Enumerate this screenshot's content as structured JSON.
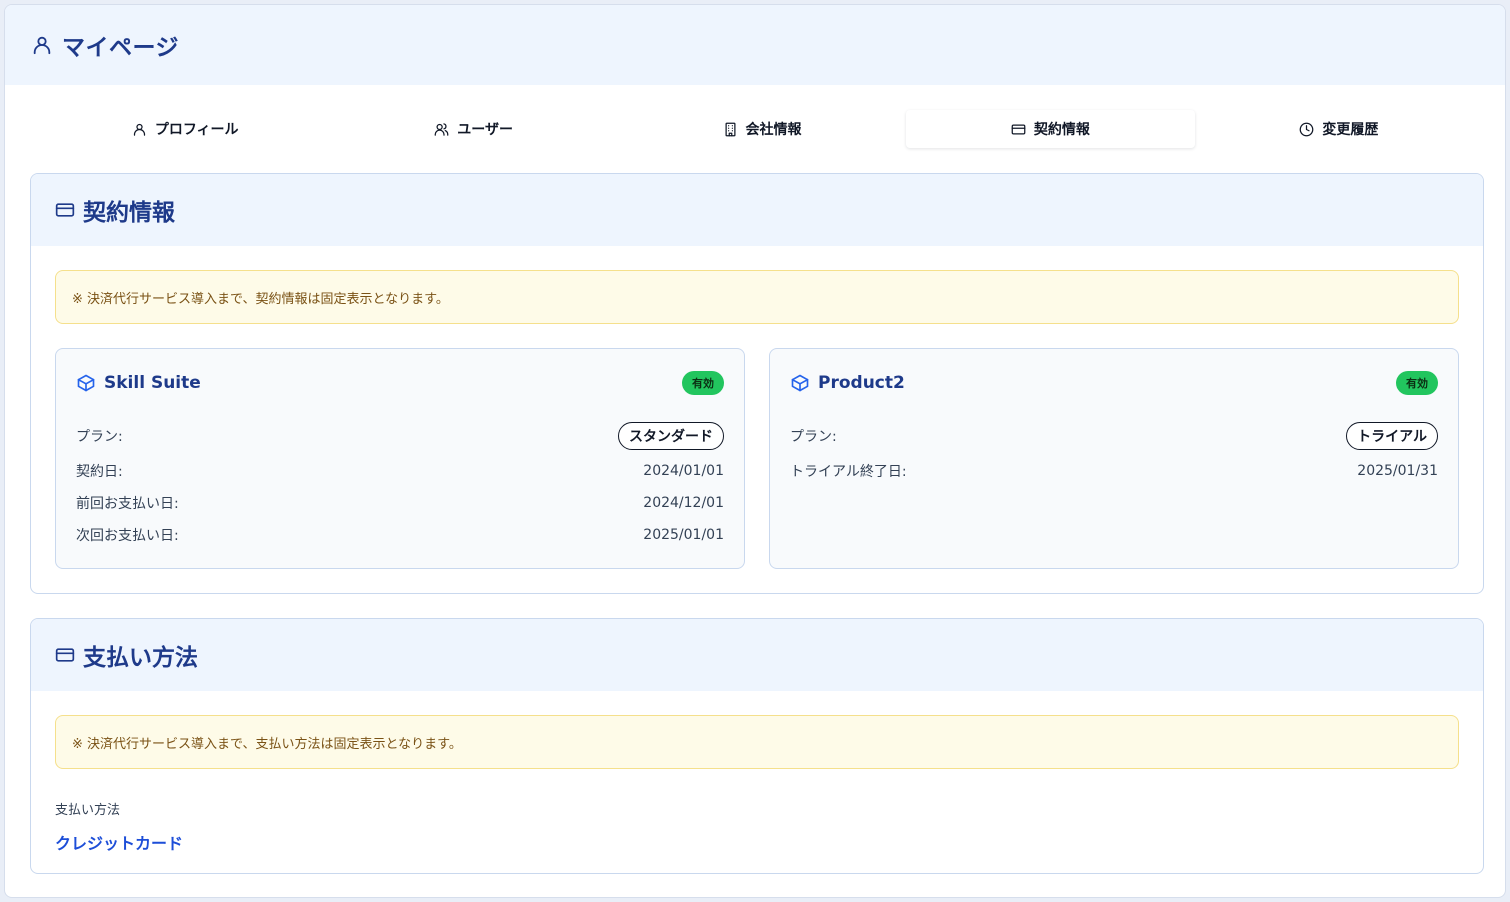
{
  "header": {
    "title": "マイページ",
    "icon": "user-icon"
  },
  "tabs": [
    {
      "label": "プロフィール",
      "icon": "user-icon"
    },
    {
      "label": "ユーザー",
      "icon": "users-icon"
    },
    {
      "label": "会社情報",
      "icon": "building-icon"
    },
    {
      "label": "契約情報",
      "icon": "credit-card-icon",
      "active": true
    },
    {
      "label": "変更履歴",
      "icon": "clock-icon"
    }
  ],
  "contract": {
    "title": "契約情報",
    "notice": "※ 決済代行サービス導入まで、契約情報は固定表示となります。",
    "products": [
      {
        "name": "Skill Suite",
        "status": "有効",
        "plan_label": "プラン:",
        "plan": "スタンダード",
        "rows": [
          {
            "label": "契約日:",
            "value": "2024/01/01"
          },
          {
            "label": "前回お支払い日:",
            "value": "2024/12/01"
          },
          {
            "label": "次回お支払い日:",
            "value": "2025/01/01"
          }
        ]
      },
      {
        "name": "Product2",
        "status": "有効",
        "plan_label": "プラン:",
        "plan": "トライアル",
        "rows": [
          {
            "label": "トライアル終了日:",
            "value": "2025/01/31"
          }
        ]
      }
    ]
  },
  "payment": {
    "title": "支払い方法",
    "notice": "※ 決済代行サービス導入まで、支払い方法は固定表示となります。",
    "method_label": "支払い方法",
    "method_value": "クレジットカード"
  },
  "colors": {
    "accent": "#1e3a8a",
    "link": "#1d4ed8",
    "active_badge": "#22c55e",
    "notice_bg": "#fefbe8",
    "header_bg": "#eef5fe"
  }
}
